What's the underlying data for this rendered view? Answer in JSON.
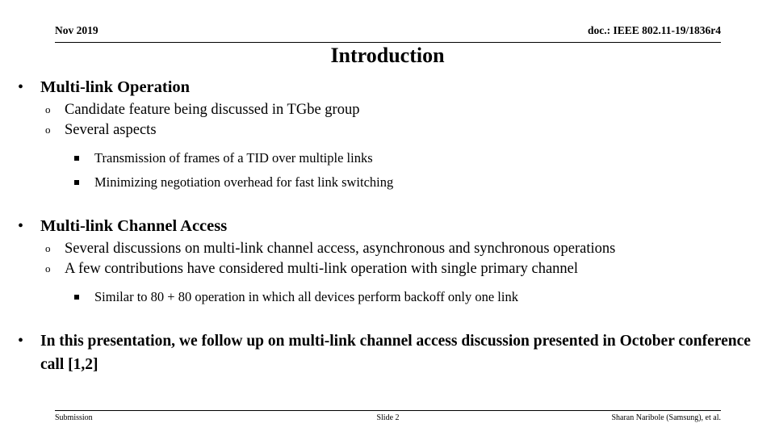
{
  "header": {
    "date": "Nov 2019",
    "doc_id": "doc.: IEEE 802.11-19/1836r4"
  },
  "title": "Introduction",
  "markers": {
    "level1": "•",
    "level2": "o",
    "level3": "§"
  },
  "content": {
    "section1": {
      "heading": "Multi-link Operation",
      "sub": [
        "Candidate feature being discussed in TGbe group",
        "Several aspects"
      ],
      "subsub": [
        "Transmission of frames of a TID over multiple links",
        "Minimizing negotiation overhead for fast link switching"
      ]
    },
    "section2": {
      "heading": "Multi-link Channel Access",
      "sub": [
        "Several discussions on multi-link channel access, asynchronous and synchronous operations",
        "A few contributions have considered multi-link operation with single primary channel"
      ],
      "subsub": [
        "Similar to 80 + 80 operation in which all devices perform backoff only one link"
      ]
    },
    "closing": "In this presentation, we follow up on multi-link channel access discussion presented in October conference call [1,2]"
  },
  "footer": {
    "left": "Submission",
    "center": "Slide 2",
    "right": "Sharan Naribole (Samsung), et al."
  }
}
